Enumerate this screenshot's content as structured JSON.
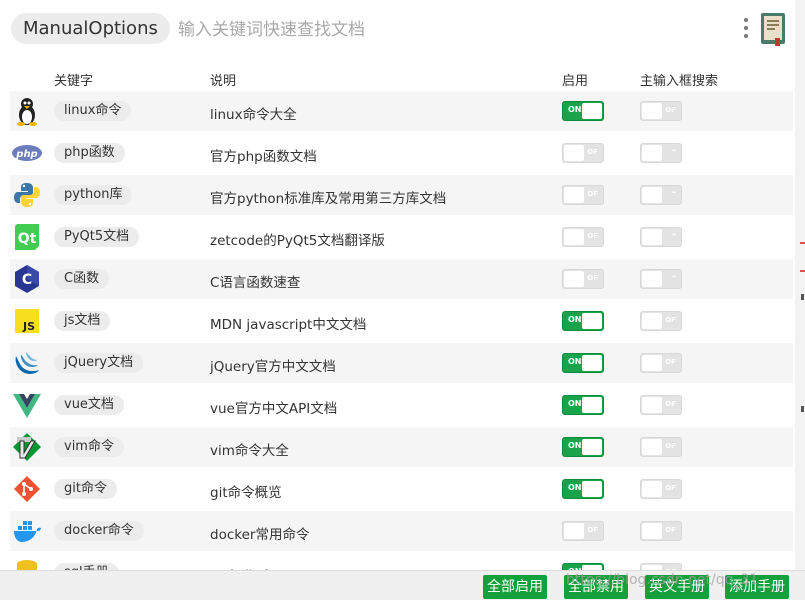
{
  "header": {
    "app_name": "ManualOptions",
    "search_placeholder": "输入关键词快速查找文档"
  },
  "columns": {
    "keyword": "关键字",
    "description": "说明",
    "enable": "启用",
    "main_search": "主输入框搜索"
  },
  "toggle_labels": {
    "on": "ON",
    "off": "OF",
    "dash": "-"
  },
  "rows": [
    {
      "icon": "linux-tux-icon",
      "keyword": "linux命令",
      "description": "linux命令大全",
      "enabled": true,
      "main_search": "off"
    },
    {
      "icon": "php-icon",
      "keyword": "php函数",
      "description": "官方php函数文档",
      "enabled": false,
      "main_search": "dash"
    },
    {
      "icon": "python-icon",
      "keyword": "python库",
      "description": "官方python标准库及常用第三方库文档",
      "enabled": false,
      "main_search": "dash"
    },
    {
      "icon": "qt-icon",
      "keyword": "PyQt5文档",
      "description": "zetcode的PyQt5文档翻译版",
      "enabled": false,
      "main_search": "dash"
    },
    {
      "icon": "c-language-icon",
      "keyword": "C函数",
      "description": "C语言函数速查",
      "enabled": false,
      "main_search": "dash"
    },
    {
      "icon": "javascript-icon",
      "keyword": "js文档",
      "description": "MDN javascript中文文档",
      "enabled": true,
      "main_search": "off"
    },
    {
      "icon": "jquery-icon",
      "keyword": "jQuery文档",
      "description": "jQuery官方中文文档",
      "enabled": true,
      "main_search": "off"
    },
    {
      "icon": "vue-icon",
      "keyword": "vue文档",
      "description": "vue官方中文API文档",
      "enabled": true,
      "main_search": "off"
    },
    {
      "icon": "vim-icon",
      "keyword": "vim命令",
      "description": "vim命令大全",
      "enabled": true,
      "main_search": "off"
    },
    {
      "icon": "git-icon",
      "keyword": "git命令",
      "description": "git命令概览",
      "enabled": true,
      "main_search": "off"
    },
    {
      "icon": "docker-icon",
      "keyword": "docker命令",
      "description": "docker常用命令",
      "enabled": false,
      "main_search": "off"
    },
    {
      "icon": "database-icon",
      "keyword": "sql手册",
      "description": "sql操作手册",
      "enabled": true,
      "main_search": "off"
    }
  ],
  "footer": {
    "enable_all": "全部启用",
    "disable_all": "全部禁用",
    "english_manual": "英文手册",
    "add_manual": "添加手册",
    "watermark": "https://blog.csdn.net/qq_31"
  },
  "colors": {
    "toggle_on": "#19a34a",
    "toggle_off": "#e3e3e3",
    "button_green": "#14a03a"
  }
}
